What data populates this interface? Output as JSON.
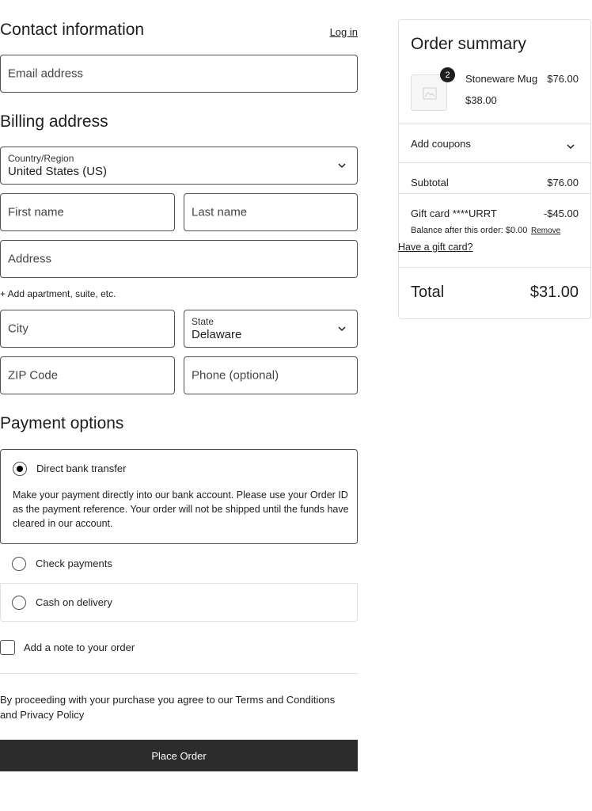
{
  "contact": {
    "title": "Contact information",
    "login_link": "Log in",
    "email_placeholder": "Email address"
  },
  "billing": {
    "title": "Billing address",
    "country_label": "Country/Region",
    "country_value": "United States (US)",
    "first_name_placeholder": "First name",
    "last_name_placeholder": "Last name",
    "address_placeholder": "Address",
    "add_apartment": "+ Add apartment, suite, etc.",
    "city_placeholder": "City",
    "state_label": "State",
    "state_value": "Delaware",
    "zip_placeholder": "ZIP Code",
    "phone_placeholder": "Phone (optional)"
  },
  "payment": {
    "title": "Payment options",
    "options": [
      {
        "label": "Direct bank transfer",
        "selected": true
      },
      {
        "label": "Check payments",
        "selected": false
      },
      {
        "label": "Cash on delivery",
        "selected": false
      }
    ],
    "bank_description": "Make your payment directly into our bank account. Please use your Order ID as the payment reference. Your order will not be shipped until the funds have cleared in our account."
  },
  "note": {
    "label": "Add a note to your order"
  },
  "terms": {
    "text": "By proceeding with your purchase you agree to our Terms and Conditions and Privacy Policy"
  },
  "place_order": {
    "label": "Place Order"
  },
  "summary": {
    "title": "Order summary",
    "item": {
      "quantity": "2",
      "name": "Stoneware Mug",
      "total": "$76.00",
      "unit_price": "$38.00"
    },
    "coupons_label": "Add coupons",
    "subtotal_label": "Subtotal",
    "subtotal_value": "$76.00",
    "giftcard_label": "Gift card ****URRT",
    "giftcard_value": "-$45.00",
    "balance_text": "Balance after this order: $0.00",
    "remove_label": "Remove",
    "have_giftcard": "Have a gift card?",
    "total_label": "Total",
    "total_value": "$31.00"
  },
  "colors": {
    "button_bg": "#2c2c2c",
    "border": "#505050",
    "divider": "#e0e0e0"
  }
}
